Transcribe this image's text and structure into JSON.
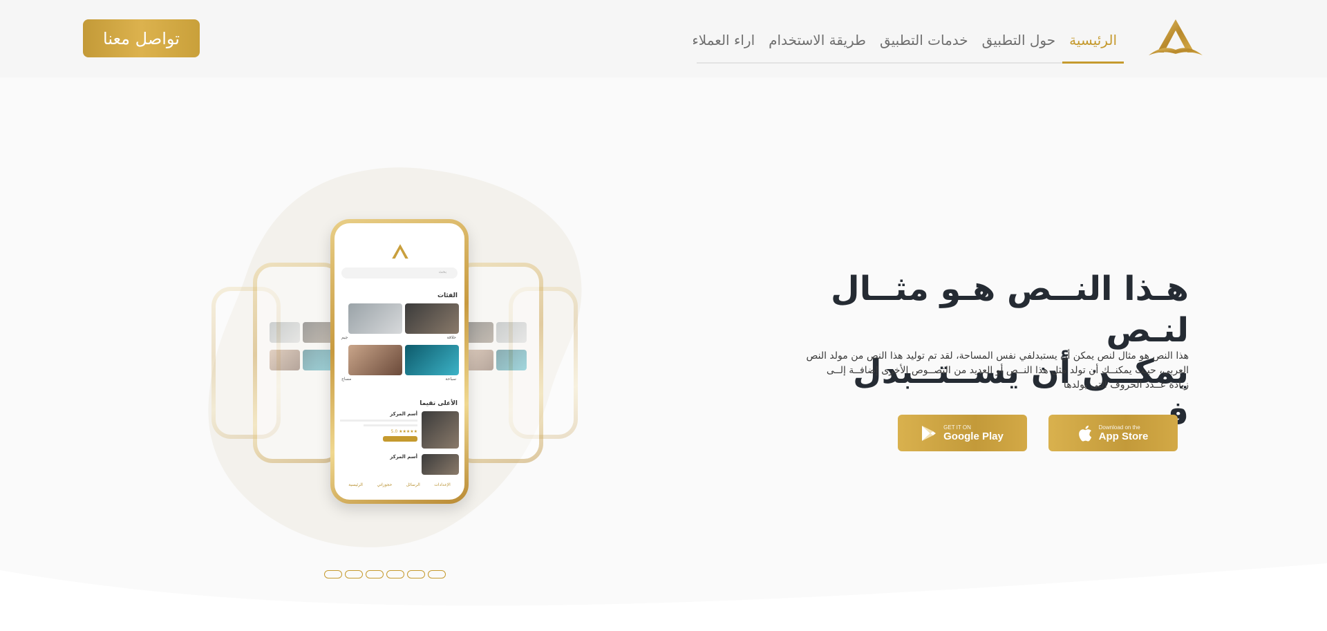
{
  "header": {
    "logo_letter": "A",
    "contact_label": "تواصل معنا",
    "nav": [
      {
        "label": "الرئيسية",
        "active": true
      },
      {
        "label": "حول التطبيق",
        "active": false
      },
      {
        "label": "خدمات التطبيق",
        "active": false
      },
      {
        "label": "طريقة الاستخدام",
        "active": false
      },
      {
        "label": "اراء العملاء",
        "active": false
      }
    ]
  },
  "hero": {
    "title_line1": "هـذا النــص هـو مثــال لنـص",
    "title_line2": "يمكــن أن يســتــبدل فـــي",
    "description": "هذا النص هو مثال لنص يمكن أن يستبدلفي نفس المساحة، لقد تم توليد هذا النص من مولد النص العربى، حيـث يمكنــك أن تولد مثل هذا النــص أو العديد من النصــوص الأخرى إضافــة إلــى زيادة عــدد الحروف التى يولدها"
  },
  "store_buttons": {
    "google": {
      "small": "GET IT ON",
      "big": "Google Play"
    },
    "apple": {
      "small": "Download on the",
      "big": "App Store"
    }
  },
  "phone_screen": {
    "search_placeholder": "بحث",
    "categories_title": "الفئات",
    "category_labels": [
      "حلاقة",
      "جيم",
      "سباحة",
      "مساج"
    ],
    "top_rated_title": "الأعلى تقيما",
    "center_name": "أسم المركز",
    "rating": "5.0",
    "tabs": [
      "الإعدادات",
      "الرسائل",
      "حجوزاتي",
      "الرئيسية"
    ]
  },
  "slider": {
    "count": 6,
    "active_index": 0
  },
  "colors": {
    "accent": "#c59a2e",
    "text_dark": "#252b33",
    "bg": "#fafafa"
  }
}
